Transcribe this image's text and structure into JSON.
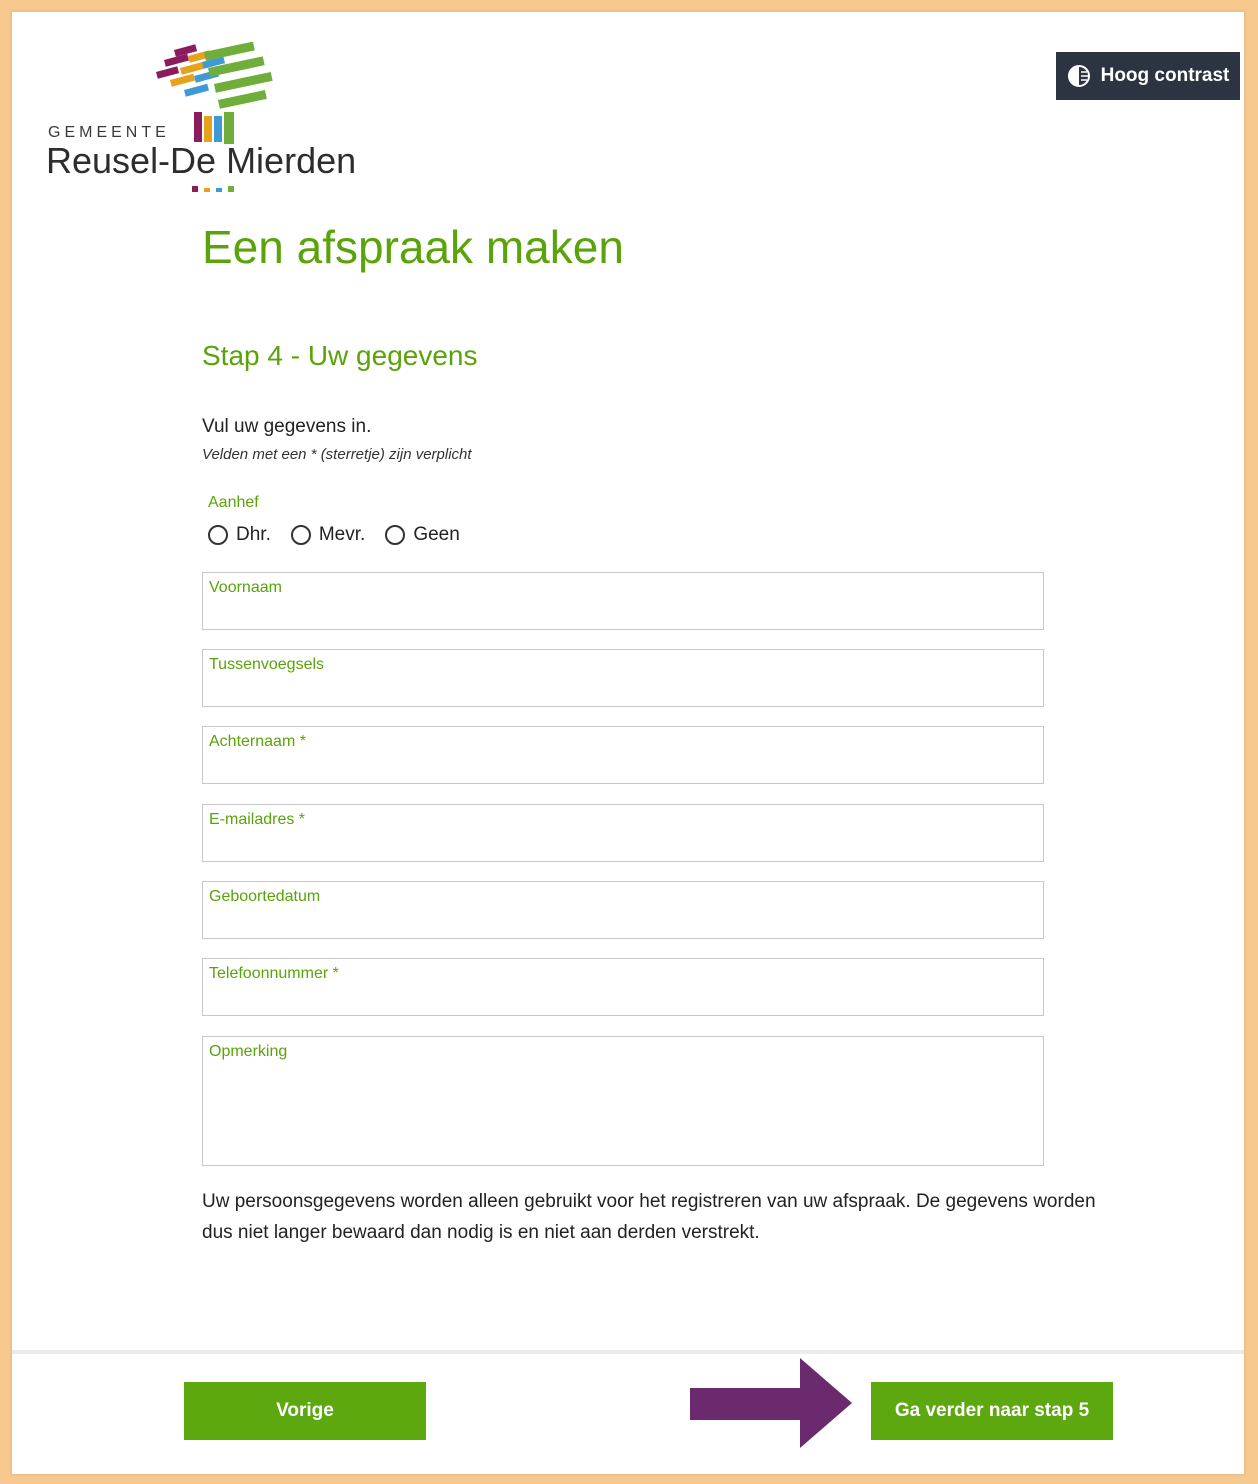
{
  "logo": {
    "gemeente": "GEMEENTE",
    "name": "Reusel-De Mierden"
  },
  "header": {
    "contrast_label": "Hoog contrast"
  },
  "page_title": "Een afspraak maken",
  "step_title": "Stap 4 - Uw gegevens",
  "intro": "Vul uw gegevens in.",
  "required_note": "Velden met een * (sterretje) zijn verplicht",
  "aanhef": {
    "label": "Aanhef",
    "options": [
      "Dhr.",
      "Mevr.",
      "Geen"
    ]
  },
  "fields": [
    {
      "label": "Voornaam"
    },
    {
      "label": "Tussenvoegsels"
    },
    {
      "label": "Achternaam *"
    },
    {
      "label": "E-mailadres *"
    },
    {
      "label": "Geboortedatum"
    },
    {
      "label": "Telefoonnummer *"
    },
    {
      "label": "Opmerking"
    }
  ],
  "privacy_text": "Uw persoonsgegevens worden alleen gebruikt voor het registreren van uw afspraak. De gegevens worden dus niet langer bewaard dan nodig is en niet aan derden verstrekt.",
  "buttons": {
    "previous": "Vorige",
    "next": "Ga verder naar stap 5"
  },
  "colors": {
    "accent": "#5aa30a",
    "button": "#5ea80f",
    "arrow": "#6b2a6e",
    "contrast_bg": "#2b3440",
    "frame": "#f7c98f"
  }
}
